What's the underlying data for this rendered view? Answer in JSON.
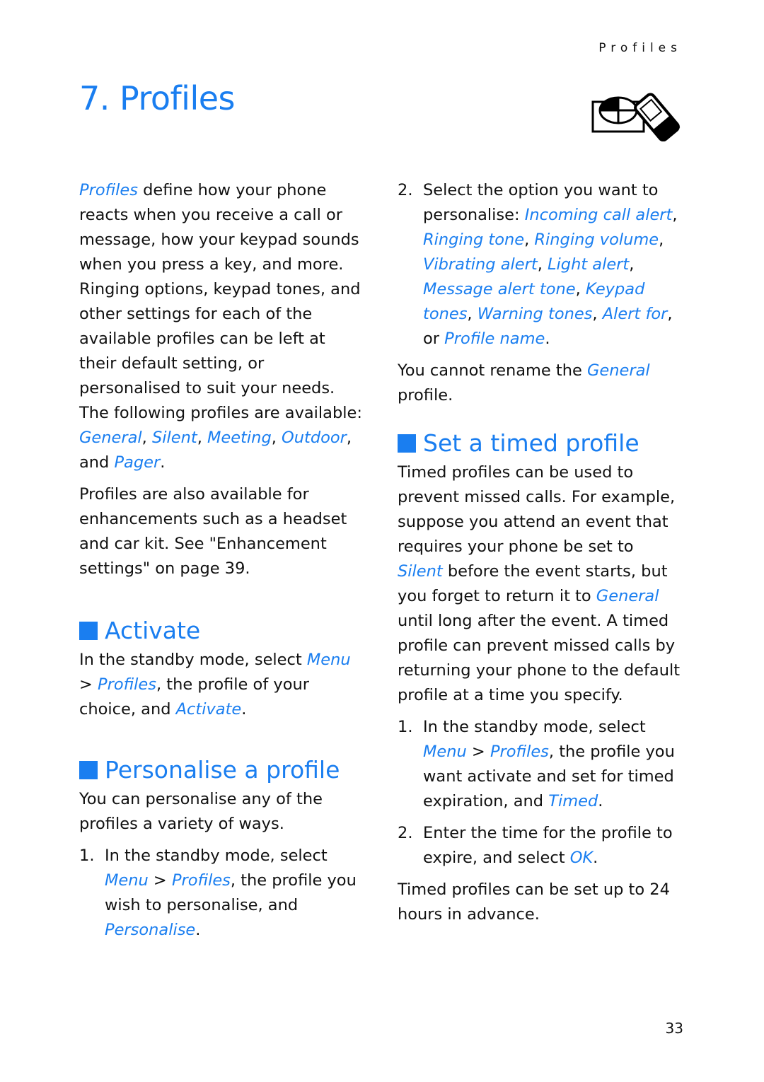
{
  "running_header": "Profiles",
  "chapter": {
    "title": "7. Profiles",
    "icon": "profiles-phone-icon"
  },
  "left": {
    "intro": {
      "t0": "Profiles",
      "t1": " define how your phone reacts when you receive a call or message, how your keypad sounds when you press a key, and more. Ringing options, keypad tones, and other settings for each of the available profiles can be left at their default setting, or personalised to suit your needs. The following profiles are available: ",
      "t2": "General",
      "t3": ", ",
      "t4": "Silent",
      "t5": ", ",
      "t6": "Meeting",
      "t7": ", ",
      "t8": "Outdoor",
      "t9": ", and ",
      "t10": "Pager",
      "t11": "."
    },
    "enhancements": "Profiles are also available for enhancements such as a headset and car kit. See \"Enhancement settings\" on page 39.",
    "activate": {
      "heading": "Activate",
      "t0": "In the standby mode, select ",
      "t1": "Menu",
      "t2": " > ",
      "t3": "Profiles",
      "t4": ", the profile of your choice, and ",
      "t5": "Activate",
      "t6": "."
    },
    "personalise": {
      "heading": "Personalise a profile",
      "intro": "You can personalise any of the profiles a variety of ways.",
      "step1": {
        "num": "1.",
        "t0": "In the standby mode, select ",
        "t1": "Menu",
        "t2": " > ",
        "t3": "Profiles",
        "t4": ", the profile you wish to personalise, and ",
        "t5": "Personalise",
        "t6": "."
      }
    }
  },
  "right": {
    "step2": {
      "num": "2.",
      "t0": "Select the option you want to personalise: ",
      "o1": "Incoming call alert",
      "c1": ", ",
      "o2": "Ringing tone",
      "c2": ", ",
      "o3": "Ringing volume",
      "c3": ", ",
      "o4": "Vibrating alert",
      "c4": ", ",
      "o5": "Light alert",
      "c5": ", ",
      "o6": "Message alert tone",
      "c6": ", ",
      "o7": "Keypad tones",
      "c7": ", ",
      "o8": "Warning tones",
      "c8": ", ",
      "o9": "Alert for",
      "c9": ", or ",
      "o10": "Profile name",
      "c10": "."
    },
    "rename": {
      "t0": "You cannot rename the ",
      "t1": "General",
      "t2": " profile."
    },
    "timed": {
      "heading": "Set a timed profile",
      "intro": {
        "t0": "Timed profiles can be used to prevent missed calls. For example, suppose you attend an event that requires your phone be set to ",
        "t1": "Silent",
        "t2": " before the event starts, but you forget to return it to ",
        "t3": "General",
        "t4": " until long after the event. A timed profile can prevent missed calls by returning your phone to the default profile at a time you specify."
      },
      "step1": {
        "num": "1.",
        "t0": "In the standby mode, select ",
        "t1": "Menu",
        "t2": " > ",
        "t3": "Profiles",
        "t4": ", the profile you want activate and set for timed expiration, and ",
        "t5": "Timed",
        "t6": "."
      },
      "step2": {
        "num": "2.",
        "t0": "Enter the time for the profile to expire, and select ",
        "t1": "OK",
        "t2": "."
      },
      "note": "Timed profiles can be set up to 24 hours in advance."
    }
  },
  "page_number": "33",
  "colors": {
    "accent": "#1a7ef0",
    "text": "#111111"
  }
}
